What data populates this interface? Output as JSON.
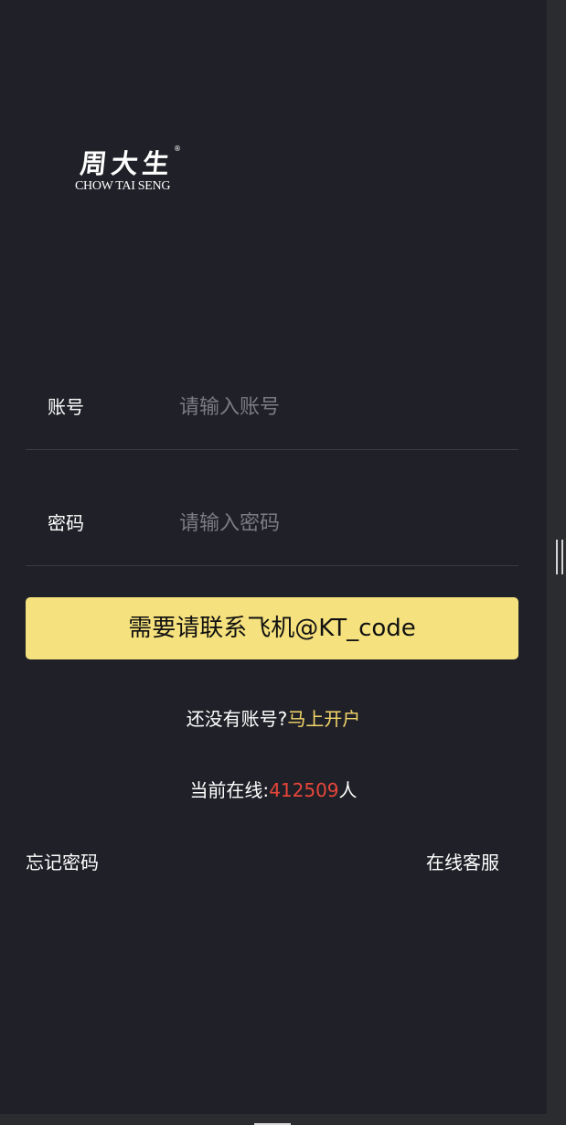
{
  "logo": {
    "chinese": "周大生",
    "registered_mark": "®",
    "english": "CHOW TAI SENG"
  },
  "form": {
    "account": {
      "label": "账号",
      "placeholder": "请输入账号",
      "value": ""
    },
    "password": {
      "label": "密码",
      "placeholder": "请输入密码",
      "value": ""
    },
    "submit_label": "需要请联系飞机@KT_code"
  },
  "register": {
    "prompt": "还没有账号?",
    "link": "马上开户"
  },
  "online": {
    "prefix": "当前在线:",
    "count": "412509",
    "suffix": "人"
  },
  "footer": {
    "forgot_password": "忘记密码",
    "customer_service": "在线客服"
  },
  "colors": {
    "background": "#202128",
    "button": "#f5e17d",
    "link_accent": "#f5d66b",
    "online_count": "#e8463a"
  }
}
